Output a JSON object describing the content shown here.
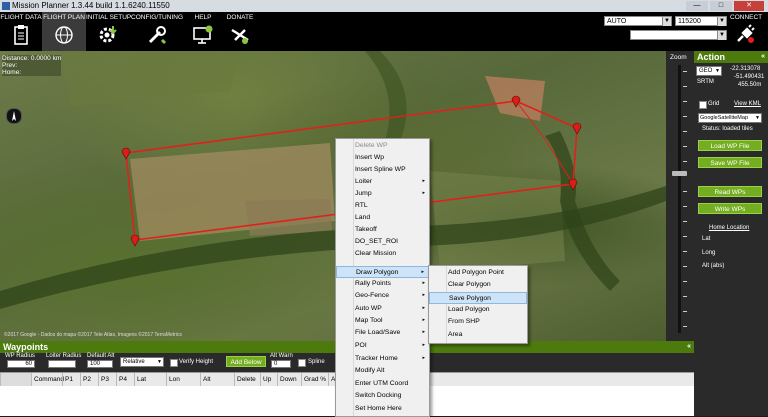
{
  "window": {
    "title": "Mission Planner 1.3.44 build 1.1.6240.11550",
    "buttons": [
      "—",
      "□",
      "✕"
    ]
  },
  "toolbar": {
    "tabs": [
      {
        "label": "FLIGHT DATA",
        "icon": "clipboard-icon"
      },
      {
        "label": "FLIGHT PLAN",
        "icon": "globe-icon"
      },
      {
        "label": "INITIAL SETUP",
        "icon": "gear-download-icon"
      },
      {
        "label": "CONFIG/TUNING",
        "icon": "wrench-icon"
      },
      {
        "label": "HELP",
        "icon": "monitor-help-icon"
      },
      {
        "label": "DONATE",
        "icon": "plane-icon"
      }
    ],
    "port": "AUTO",
    "baud": "115200",
    "connect_label": "CONNECT"
  },
  "map": {
    "distance": "Distance: 0.0000 km",
    "prev": "Prev: ",
    "home": "Home: ",
    "copyright": "©2017 Google - Dados do mapa ©2017 Tele Atlas, Imagens ©2017 TerraMetrics",
    "zoom_label": "Zoom"
  },
  "context_menu": {
    "items": [
      {
        "label": "Delete WP",
        "disabled": true,
        "submenu": false
      },
      {
        "label": "Insert Wp",
        "submenu": false
      },
      {
        "label": "Insert Spline WP",
        "submenu": false
      },
      {
        "label": "Loiter",
        "submenu": true
      },
      {
        "label": "Jump",
        "submenu": true
      },
      {
        "label": "RTL",
        "submenu": false
      },
      {
        "label": "Land",
        "submenu": false
      },
      {
        "label": "Takeoff",
        "submenu": false
      },
      {
        "label": "DO_SET_ROI",
        "submenu": false
      },
      {
        "label": "Clear Mission",
        "submenu": false
      },
      {
        "label": "Draw Polygon",
        "submenu": true,
        "highlighted": true
      },
      {
        "label": "Rally Points",
        "submenu": true
      },
      {
        "label": "Geo-Fence",
        "submenu": true
      },
      {
        "label": "Auto WP",
        "submenu": true
      },
      {
        "label": "Map Tool",
        "submenu": true
      },
      {
        "label": "File Load/Save",
        "submenu": true
      },
      {
        "label": "POI",
        "submenu": true
      },
      {
        "label": "Tracker Home",
        "submenu": true
      },
      {
        "label": "Modify Alt",
        "submenu": false
      },
      {
        "label": "Enter UTM Coord",
        "submenu": false
      },
      {
        "label": "Switch Docking",
        "submenu": false
      },
      {
        "label": "Set Home Here",
        "submenu": false
      }
    ],
    "submenu_items": [
      {
        "label": "Add Polygon Point"
      },
      {
        "label": "Clear Polygon"
      },
      {
        "label": "Save Polygon",
        "highlighted": true
      },
      {
        "label": "Load Polygon"
      },
      {
        "label": "From SHP"
      },
      {
        "label": "Area"
      }
    ],
    "submenu_arrow": "▸"
  },
  "action": {
    "title": "Action",
    "collapse": "«",
    "coord_type": "GEO",
    "lat": "-22.313078",
    "lng": "-51.490431",
    "alt": "455.50m",
    "srtm": "SRTM",
    "grid_label": "Grid",
    "view_kml": "View KML",
    "map_type": "GoogleSatelliteMap",
    "status": "Status: loaded tiles",
    "buttons": [
      "Load WP File",
      "Save WP File",
      "Read WPs",
      "Write WPs"
    ],
    "home_location": "Home Location",
    "home_fields": [
      "Lat",
      "Long",
      "Alt (abs)"
    ]
  },
  "waypoints": {
    "title": "Waypoints",
    "collapse": "«",
    "wp_radius_label": "WP Radius",
    "wp_radius": "60",
    "loiter_radius_label": "Loiter Radius",
    "loiter_radius": "",
    "default_alt_label": "Default Alt",
    "default_alt": "100",
    "frame": "Relative",
    "verify_height": "Verify Height",
    "add_below": "Add Below",
    "alt_warn_label": "Alt Warn",
    "alt_warn": "0",
    "spline": "Spline",
    "columns": [
      "Command",
      "P1",
      "P2",
      "P3",
      "P4",
      "Lat",
      "Lon",
      "Alt",
      "Delete",
      "Up",
      "Down",
      "Grad %",
      "A"
    ]
  },
  "colors": {
    "accent_green": "#74ad1f",
    "header_green": "#4d7a0d",
    "route_red": "#e0211b"
  }
}
